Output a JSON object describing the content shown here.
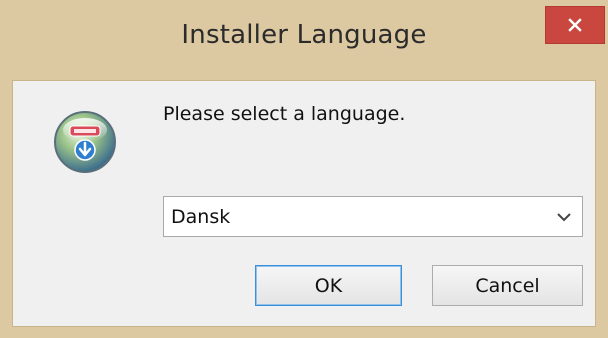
{
  "window": {
    "title": "Installer Language",
    "close_label": "×"
  },
  "dialog": {
    "icon": "installer-globe-icon",
    "message": "Please select a language.",
    "language_select": {
      "selected": "Dansk"
    },
    "buttons": {
      "ok": "OK",
      "cancel": "Cancel"
    }
  },
  "colors": {
    "titlebar": "#dcc9a2",
    "close_button": "#c9473f",
    "client_background": "#f0f0f0",
    "focus_border": "#3c8fd8"
  }
}
